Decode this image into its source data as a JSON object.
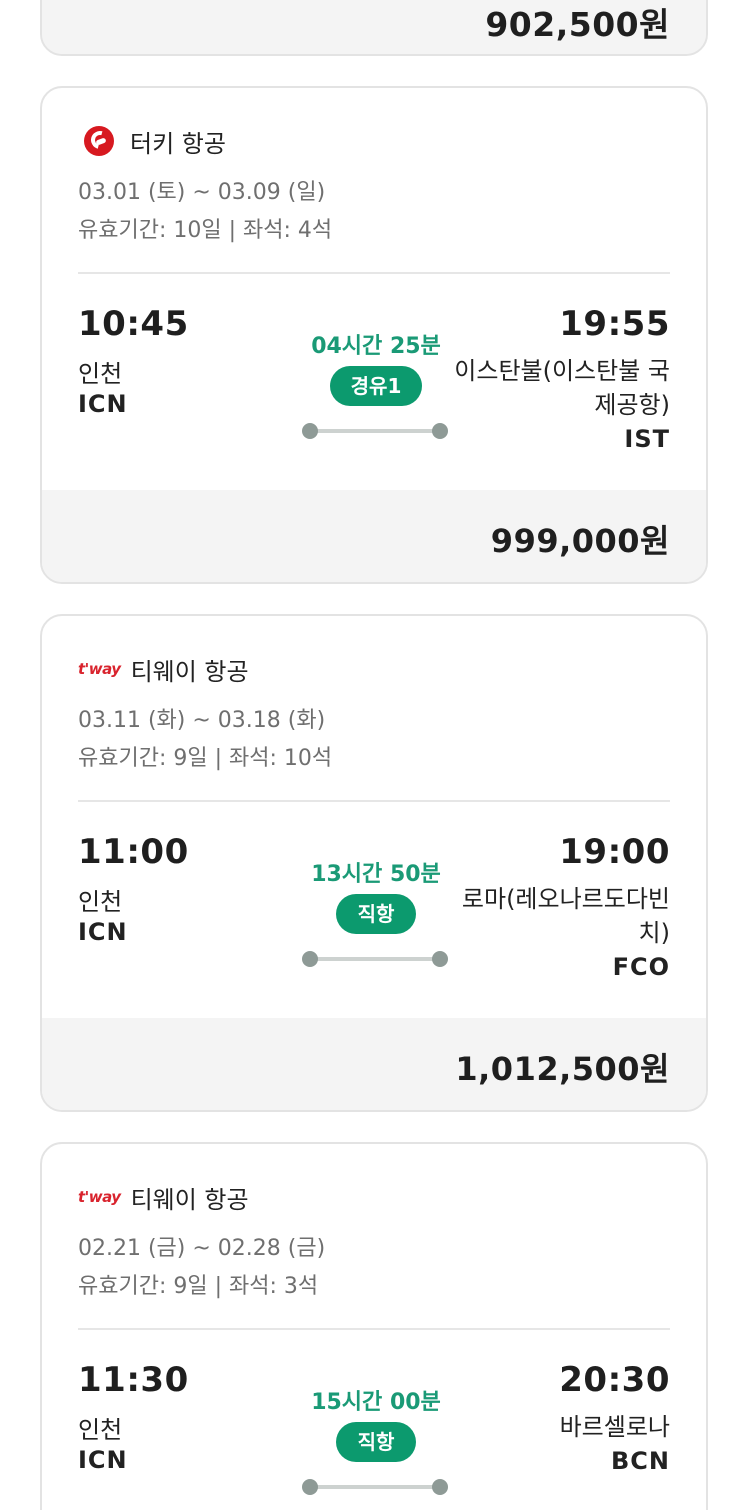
{
  "top_card": {
    "price": "902,500원"
  },
  "flights": [
    {
      "airline": "터키 항공",
      "airline_logo": "turkish-airlines-logo",
      "dates": "03.01 (토) ~ 03.09 (일)",
      "validity": "유효기간: 10일 | 좌석: 4석",
      "departure": {
        "time": "10:45",
        "city": "인천",
        "code": "ICN"
      },
      "arrival": {
        "time": "19:55",
        "city": "이스탄불(이스탄불 국제공항)",
        "code": "IST"
      },
      "duration": "04시간 25분",
      "stop_badge": "경유1",
      "price": "999,000원"
    },
    {
      "airline": "티웨이 항공",
      "airline_logo": "tway-logo",
      "logo_text": "t'way",
      "dates": "03.11 (화) ~ 03.18 (화)",
      "validity": "유효기간: 9일 | 좌석: 10석",
      "departure": {
        "time": "11:00",
        "city": "인천",
        "code": "ICN"
      },
      "arrival": {
        "time": "19:00",
        "city": "로마(레오나르도다빈치)",
        "code": "FCO"
      },
      "duration": "13시간 50분",
      "stop_badge": "직항",
      "price": "1,012,500원"
    },
    {
      "airline": "티웨이 항공",
      "airline_logo": "tway-logo",
      "logo_text": "t'way",
      "dates": "02.21 (금) ~ 02.28 (금)",
      "validity": "유효기간: 9일 | 좌석: 3석",
      "departure": {
        "time": "11:30",
        "city": "인천",
        "code": "ICN"
      },
      "arrival": {
        "time": "20:30",
        "city": "바르셀로나",
        "code": "BCN"
      },
      "duration": "15시간 00분",
      "stop_badge": "직항"
    }
  ],
  "colors": {
    "accent_green": "#0c9a6e",
    "duration_green": "#1a9a76",
    "turkish_red": "#d71920",
    "tway_red": "#d9232d"
  }
}
